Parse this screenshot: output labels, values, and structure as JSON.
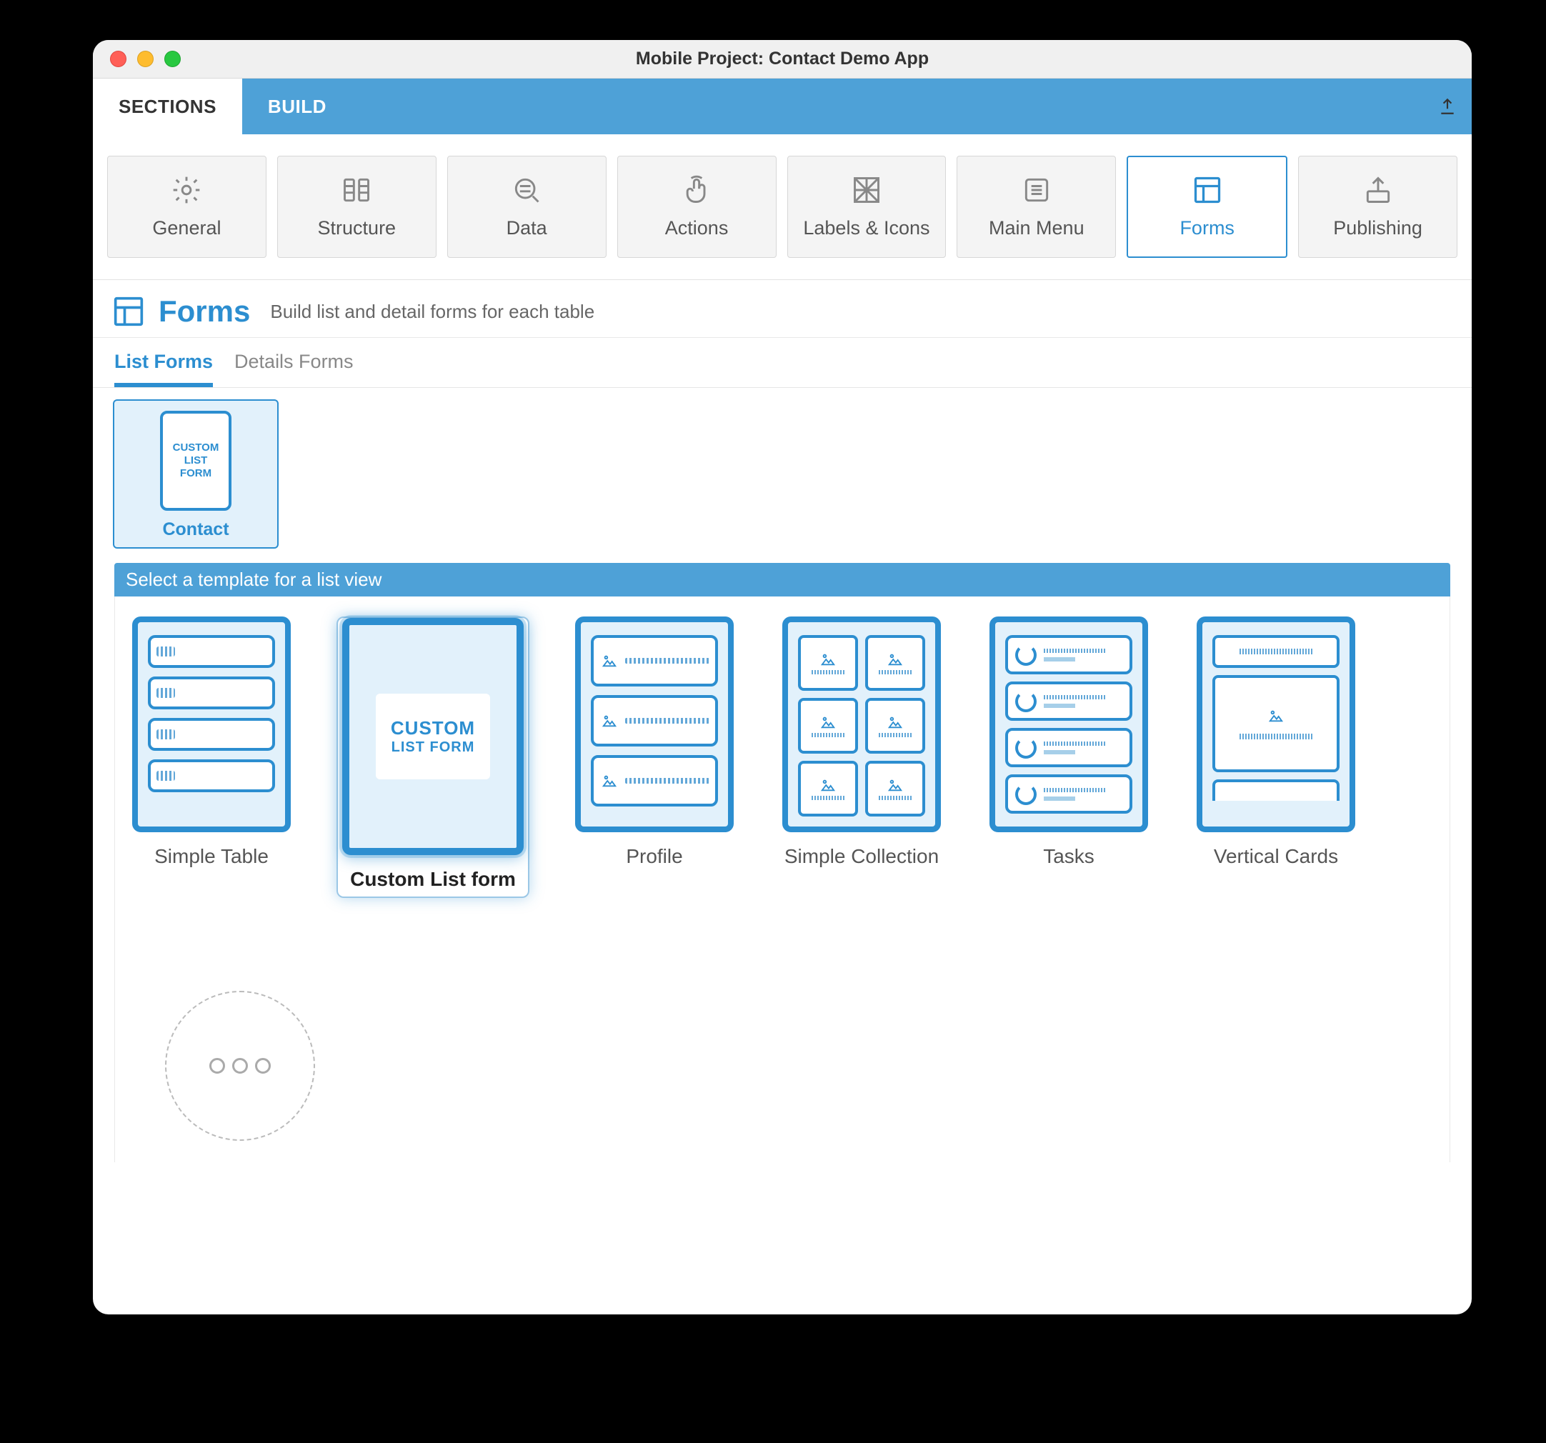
{
  "window": {
    "title": "Mobile Project: Contact Demo App"
  },
  "tabs": {
    "sections": "SECTIONS",
    "build": "BUILD"
  },
  "sections": {
    "items": [
      {
        "label": "General"
      },
      {
        "label": "Structure"
      },
      {
        "label": "Data"
      },
      {
        "label": "Actions"
      },
      {
        "label": "Labels & Icons"
      },
      {
        "label": "Main Menu"
      },
      {
        "label": "Forms"
      },
      {
        "label": "Publishing"
      }
    ],
    "active": "Forms"
  },
  "page": {
    "title": "Forms",
    "subtitle": "Build list and detail forms for each table"
  },
  "subtabs": {
    "list_forms": "List Forms",
    "details_forms": "Details Forms",
    "active": "List Forms"
  },
  "tables": [
    {
      "name": "Contact",
      "thumb_text": "CUSTOM LIST FORM"
    }
  ],
  "template_picker": {
    "header": "Select a template for a list view",
    "templates": [
      {
        "label": "Simple Table",
        "id": "simple-table"
      },
      {
        "label": "Custom List form",
        "id": "custom-list-form",
        "badge_l1": "CUSTOM",
        "badge_l2": "LIST FORM"
      },
      {
        "label": "Profile",
        "id": "profile"
      },
      {
        "label": "Simple Collection",
        "id": "simple-collection"
      },
      {
        "label": "Tasks",
        "id": "tasks"
      },
      {
        "label": "Vertical Cards",
        "id": "vertical-cards"
      }
    ],
    "selected": "custom-list-form"
  }
}
